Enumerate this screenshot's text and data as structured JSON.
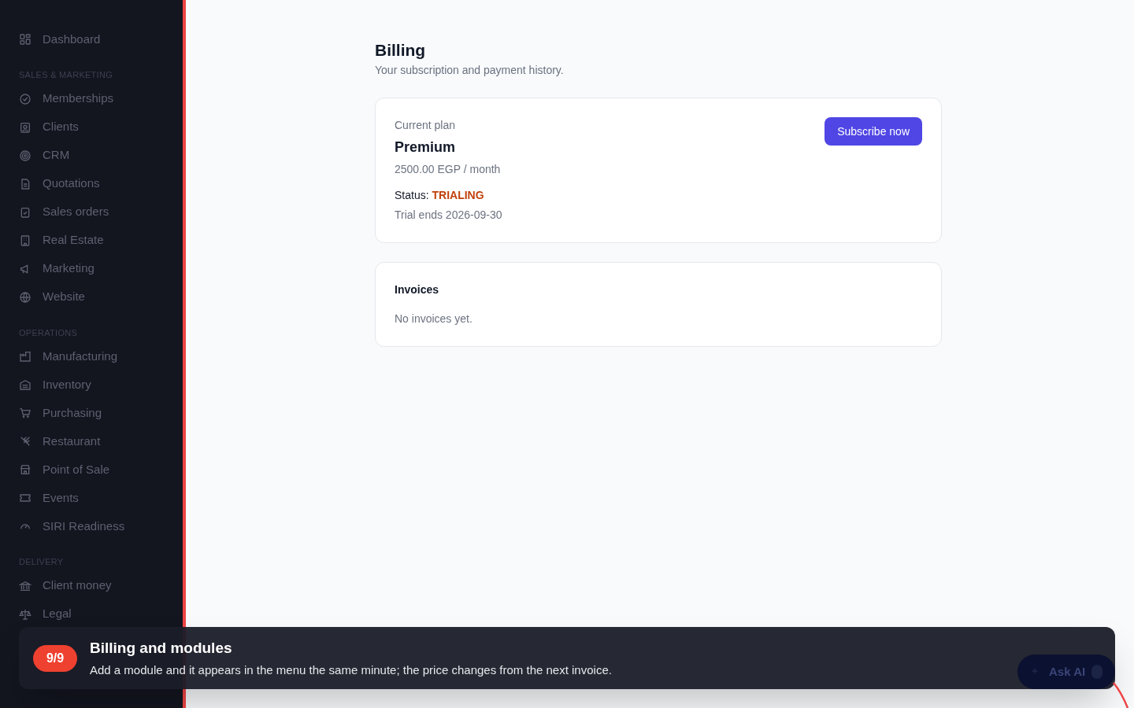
{
  "sidebar": {
    "top_item": {
      "label": "Dashboard"
    },
    "sections": [
      {
        "title": "SALES & MARKETING",
        "items": [
          {
            "label": "Memberships"
          },
          {
            "label": "Clients"
          },
          {
            "label": "CRM"
          },
          {
            "label": "Quotations"
          },
          {
            "label": "Sales orders"
          },
          {
            "label": "Real Estate"
          },
          {
            "label": "Marketing"
          },
          {
            "label": "Website"
          }
        ]
      },
      {
        "title": "OPERATIONS",
        "items": [
          {
            "label": "Manufacturing"
          },
          {
            "label": "Inventory"
          },
          {
            "label": "Purchasing"
          },
          {
            "label": "Restaurant"
          },
          {
            "label": "Point of Sale"
          },
          {
            "label": "Events"
          },
          {
            "label": "SIRI Readiness"
          }
        ]
      },
      {
        "title": "DELIVERY",
        "items": [
          {
            "label": "Client money"
          },
          {
            "label": "Legal"
          }
        ]
      }
    ]
  },
  "page": {
    "title": "Billing",
    "subtitle": "Your subscription and payment history."
  },
  "plan_card": {
    "caption": "Current plan",
    "plan": "Premium",
    "price": "2500.00 EGP / month",
    "status_label": "Status:",
    "status": "TRIALING",
    "trial_note": "Trial ends 2026-09-30",
    "button": "Subscribe now"
  },
  "invoices_card": {
    "title": "Invoices",
    "empty_text": "No invoices yet."
  },
  "tour": {
    "step": "9/9",
    "title": "Billing and modules",
    "text": "Add a module and it appears in the menu the same minute; the price changes from the next invoice."
  },
  "ask_ai": {
    "label": "Ask AI"
  }
}
